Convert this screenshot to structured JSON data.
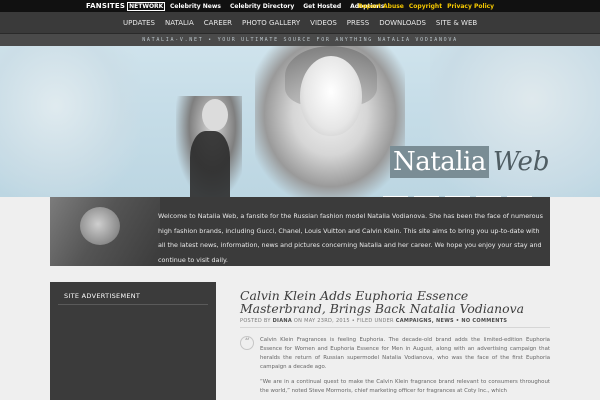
{
  "network_bar": {
    "logo_word": "FANSITES",
    "logo_box": "NETWORK",
    "links": [
      "Celebrity News",
      "Celebrity Directory",
      "Get Hosted",
      "Adoptions"
    ],
    "right_links": [
      "Report Abuse",
      "Copyright",
      "Privacy Policy"
    ],
    "accent_color": "#f5c800"
  },
  "nav": {
    "items": [
      "UPDATES",
      "NATALIA",
      "CAREER",
      "PHOTO GALLERY",
      "VIDEOS",
      "PRESS",
      "DOWNLOADS",
      "SITE & WEB"
    ]
  },
  "tagline": "NATALIA-V.NET • YOUR ULTIMATE SOURCE FOR ANYTHING NATALIA VODIANOVA",
  "header": {
    "title_part1": "Natalia",
    "title_part2": "Web",
    "thumbnail_colors": [
      "#c9908a",
      "#8b1a17",
      "#a8151c",
      "#e08a79",
      "#6b3b28"
    ]
  },
  "welcome": {
    "text": "Welcome to Natalia Web, a fansite for the Russian fashion model Natalia Vodianova. She has been the face of numerous high fashion brands, including Gucci, Chanel, Louis Vuitton and Calvin Klein. This site aims to bring you up-to-date with all the latest news, information, news and pictures concerning Natalia and her career. We hope you enjoy your stay and continue to visit daily."
  },
  "sidebar": {
    "heading": "SITE ADVERTISEMENT"
  },
  "post": {
    "title": "Calvin Klein Adds Euphoria Essence Masterbrand, Brings Back Natalia Vodianova",
    "meta_posted_by": "POSTED BY",
    "meta_author": "DIANA",
    "meta_on": "ON MAY 23RD, 2015 •",
    "meta_filed": "FILED UNDER",
    "meta_categories": "CAMPAIGNS, NEWS",
    "meta_comments": "• NO COMMENTS",
    "quote_glyph": "“",
    "paragraph1": "Calvin Klein Fragrances is feeling Euphoria. The decade-old brand adds the limited-edition Euphoria Essence for Women and Euphoria Essence for Men in August, along with an advertising campaign that heralds the return of Russian supermodel Natalia Vodianova, who was the face of the first Euphoria campaign a decade ago.",
    "paragraph2": "“We are in a continual quest to make the Calvin Klein fragrance brand relevant to consumers throughout the world,” noted Steve Mormoris, chief marketing officer for fragrances at Coty Inc., which"
  }
}
